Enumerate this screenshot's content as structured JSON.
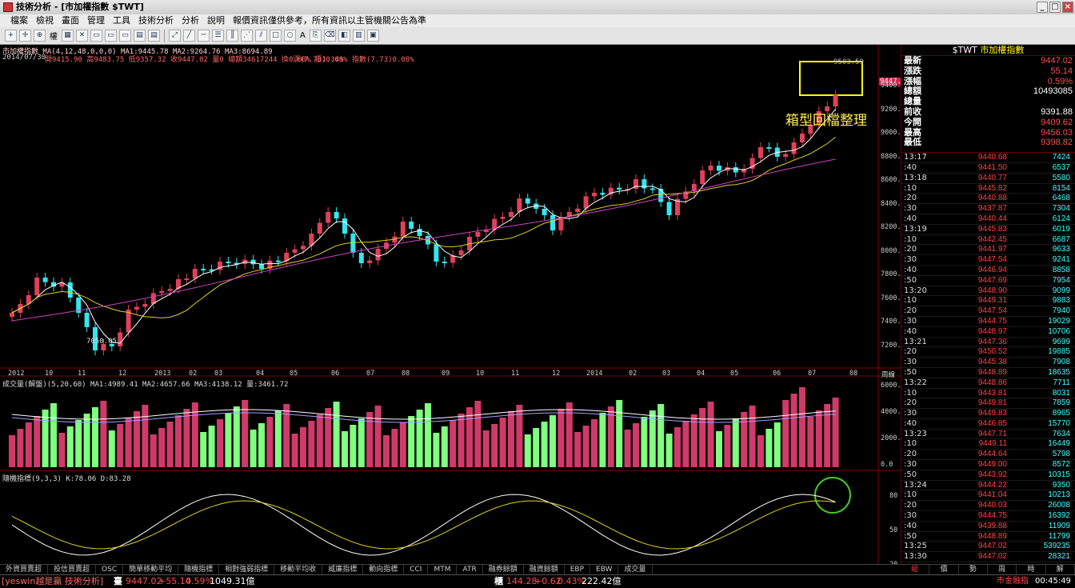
{
  "window": {
    "title": "技術分析 - [市加權指數 $TWT]",
    "min": "_",
    "max": "□",
    "close": "×"
  },
  "menu": [
    "檔案",
    "檢視",
    "畫面",
    "管理",
    "工具",
    "技術分析",
    "分析",
    "說明",
    "報價資訊僅供參考，所有資訊以主管機關公告為準"
  ],
  "toolbar": {
    "label_quan": "權",
    "label_a": "A"
  },
  "price_panel": {
    "header1": "市加權指數  MA(4,12,48,0,0,0)  MA1:9445.78  MA2:9264.76  MA3:8694.89",
    "header2_date": "2014/07/30",
    "header2_vals": "開9415.90  高9483.75  低9357.32  收9447.02  量0  總額34617244  換0.00%  振1.34%",
    "header2_chg": "漲(7.73)0.08%  指數(7.73)0.08%",
    "annotation": "箱型回檔整理",
    "low_label": "7050.05",
    "high_label": "9503.59",
    "last_tag": "9447.0",
    "yaxis": [
      "9400.0",
      "9200.0",
      "9000.0",
      "8800.0",
      "8600.0",
      "8400.0",
      "8200.0",
      "8000.0",
      "7800.0",
      "7600.0",
      "7400.0",
      "7200.0"
    ],
    "xaxis": [
      "2012",
      "10",
      "11",
      "12",
      "2013",
      "02",
      "03",
      "04",
      "05",
      "06",
      "07",
      "08",
      "09",
      "10",
      "11",
      "12",
      "2014",
      "02",
      "03",
      "04",
      "05",
      "06",
      "07",
      "08"
    ],
    "period": "周線"
  },
  "volume_panel": {
    "header": "成交量(解盤)(5,20,60)  MA1:4989.41  MA2:4657.66  MA3:4138.12  量:3461.72",
    "yaxis": [
      "6000.0",
      "4000.0",
      "2000.0",
      "0.0"
    ]
  },
  "kd_panel": {
    "header": "隨機指標(9,3,3)  K:78.06  D:83.28",
    "yaxis": [
      "80",
      "50",
      "20"
    ]
  },
  "bottom_tabs": [
    "外資買賣超",
    "投信買賣超",
    "OSC",
    "簡單移動平均",
    "隨機指標",
    "相對強弱指標",
    "移動平均收",
    "威廉指標",
    "動向指標",
    "CCI",
    "MTM",
    "ATR",
    "融券餘額",
    "融資餘額",
    "EBP",
    "EBW",
    "成交量"
  ],
  "quote": {
    "symbol": "$TWT",
    "name": "市加權指數",
    "fields": [
      {
        "k": "最新",
        "v": "9447.02",
        "c": "#ff4d4d"
      },
      {
        "k": "漲跌",
        "v": "55.14",
        "c": "#ff4d4d"
      },
      {
        "k": "漲幅",
        "v": "0.59%",
        "c": "#ff4d4d"
      },
      {
        "k": "總額",
        "v": "10493085",
        "c": "#ffffff"
      },
      {
        "k": "總量",
        "v": "",
        "c": "#ffffff"
      },
      {
        "k": "前收",
        "v": "9391.88",
        "c": "#ffffff"
      },
      {
        "k": "今開",
        "v": "9409.62",
        "c": "#ff4d4d"
      },
      {
        "k": "最高",
        "v": "9456.03",
        "c": "#ff4d4d"
      },
      {
        "k": "最低",
        "v": "9398.82",
        "c": "#ff4d4d"
      }
    ],
    "ticks": [
      [
        "13:17",
        "9440.68",
        "7424"
      ],
      [
        ":40",
        "9441.50",
        "6537"
      ],
      [
        "13:18",
        "9440.77",
        "5580"
      ],
      [
        ":10",
        "9445.82",
        "8154"
      ],
      [
        ":20",
        "9440.88",
        "6468"
      ],
      [
        ":30",
        "9437.87",
        "7304"
      ],
      [
        ":40",
        "9440.44",
        "6124"
      ],
      [
        "13:19",
        "9445.83",
        "6019"
      ],
      [
        ":10",
        "9442.45",
        "6687"
      ],
      [
        ":20",
        "9441.97",
        "9633"
      ],
      [
        ":30",
        "9447.54",
        "9241"
      ],
      [
        ":40",
        "9446.94",
        "8858"
      ],
      [
        ":50",
        "9447.69",
        "7954"
      ],
      [
        "13:20",
        "9448.90",
        "9099"
      ],
      [
        ":10",
        "9449.31",
        "9883"
      ],
      [
        ":20",
        "9447.54",
        "7940"
      ],
      [
        ":30",
        "9444.75",
        "19029"
      ],
      [
        ":40",
        "9448.97",
        "10706"
      ],
      [
        "13:21",
        "9447.36",
        "9699"
      ],
      [
        ":20",
        "9450.52",
        "19885"
      ],
      [
        ":30",
        "9445.38",
        "7908"
      ],
      [
        ":50",
        "9448.89",
        "18635"
      ],
      [
        "13:22",
        "9448.86",
        "7711"
      ],
      [
        ":10",
        "9443.81",
        "8031"
      ],
      [
        ":20",
        "9449.81",
        "7859"
      ],
      [
        ":30",
        "9449.83",
        "8965"
      ],
      [
        ":40",
        "9446.85",
        "15770"
      ],
      [
        "13:23",
        "9447.71",
        "7634"
      ],
      [
        ":10",
        "9449.11",
        "16449"
      ],
      [
        ":20",
        "9444.64",
        "5798"
      ],
      [
        ":30",
        "9449.00",
        "8572"
      ],
      [
        ":50",
        "9443.92",
        "10315"
      ],
      [
        "13:24",
        "9444.22",
        "9350"
      ],
      [
        ":10",
        "9441.04",
        "10213"
      ],
      [
        ":20",
        "9440.03",
        "26008"
      ],
      [
        ":30",
        "9444.75",
        "16392"
      ],
      [
        ":40",
        "9439.88",
        "11909"
      ],
      [
        ":50",
        "9448.89",
        "11799"
      ],
      [
        "13:25",
        "9447.02",
        "539235"
      ],
      [
        "13:30",
        "9447.02",
        "28321"
      ]
    ]
  },
  "quote_tabs": [
    "組",
    "價",
    "勢",
    "周",
    "時",
    "解"
  ],
  "status": {
    "user": "[yeswin越是贏 技術分析]",
    "idx_label": "臺",
    "idx_price": "9447.02",
    "idx_chg": "+55.14",
    "idx_pct": "0.59%",
    "idx_amt": "1049.31億",
    "otc_label": "櫃",
    "otc_price": "144.28",
    "otc_chg": "+0.62",
    "otc_pct": "0.43%",
    "otc_amt": "222.42億",
    "market": "市金融指",
    "time": "00:45:49"
  },
  "colors": {
    "up": "#e0405a",
    "down": "#33e6f0",
    "vol_up": "#d03a6a",
    "vol_down": "#80ff80",
    "ma1": "#ffffff",
    "ma2": "#e0d020",
    "ma3": "#d040c0",
    "k": "#ffffff",
    "d": "#e0d020"
  }
}
